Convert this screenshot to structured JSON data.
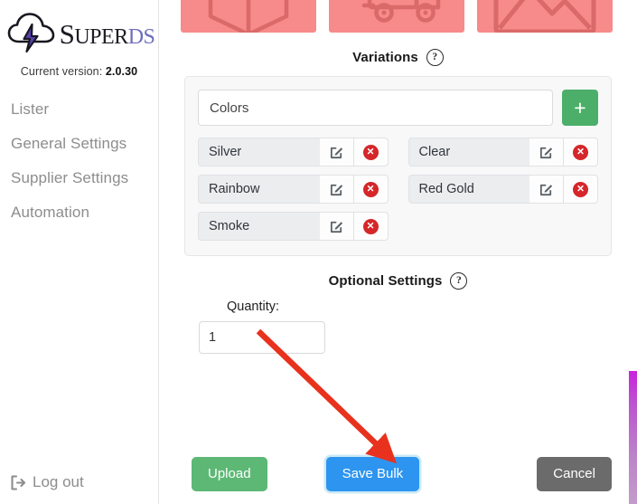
{
  "sidebar": {
    "brand": {
      "name_part1": "S",
      "name_super": "UPER",
      "name_ds": "DS",
      "logo_icon": "cloud-lightning-icon"
    },
    "version_label": "Current version:",
    "version_value": "2.0.30",
    "items": [
      {
        "label": "Lister",
        "name": "sidebar-item-lister"
      },
      {
        "label": "General Settings",
        "name": "sidebar-item-general-settings"
      },
      {
        "label": "Supplier Settings",
        "name": "sidebar-item-supplier-settings"
      },
      {
        "label": "Automation",
        "name": "sidebar-item-automation"
      }
    ],
    "logout_label": "Log out",
    "logout_icon": "logout-icon"
  },
  "main": {
    "media_cards": [
      {
        "icon": "box-icon",
        "alt": "box placeholder"
      },
      {
        "icon": "truck-icon",
        "alt": "shipping placeholder"
      },
      {
        "icon": "image-icon",
        "alt": "image placeholder"
      }
    ],
    "variations": {
      "title": "Variations",
      "help_icon": "question-mark-circle-icon",
      "input_value": "Colors",
      "input_placeholder": "Colors",
      "add_button_label": "+",
      "edit_icon": "pencil-square-icon",
      "delete_icon": "delete-circle-icon",
      "items": [
        {
          "label": "Silver"
        },
        {
          "label": "Clear"
        },
        {
          "label": "Rainbow"
        },
        {
          "label": "Red Gold"
        },
        {
          "label": "Smoke"
        }
      ]
    },
    "optional_settings": {
      "title": "Optional Settings",
      "help_icon": "question-mark-circle-icon",
      "quantity_label": "Quantity:",
      "quantity_value": "1",
      "quantity_placeholder": "1"
    },
    "actions": {
      "upload_label": "Upload",
      "save_label": "Save Bulk",
      "cancel_label": "Cancel"
    }
  },
  "annotation": {
    "type": "arrow",
    "color": "#e8321d",
    "points_to": "Save Bulk"
  },
  "colors": {
    "accent_green": "#4caf69",
    "accent_blue": "#2d95f0",
    "accent_red": "#d5262a",
    "accent_gray": "#6b6b6b",
    "placeholder_pink": "#f78a8a",
    "scrollbar_magenta": "#c923dd"
  }
}
